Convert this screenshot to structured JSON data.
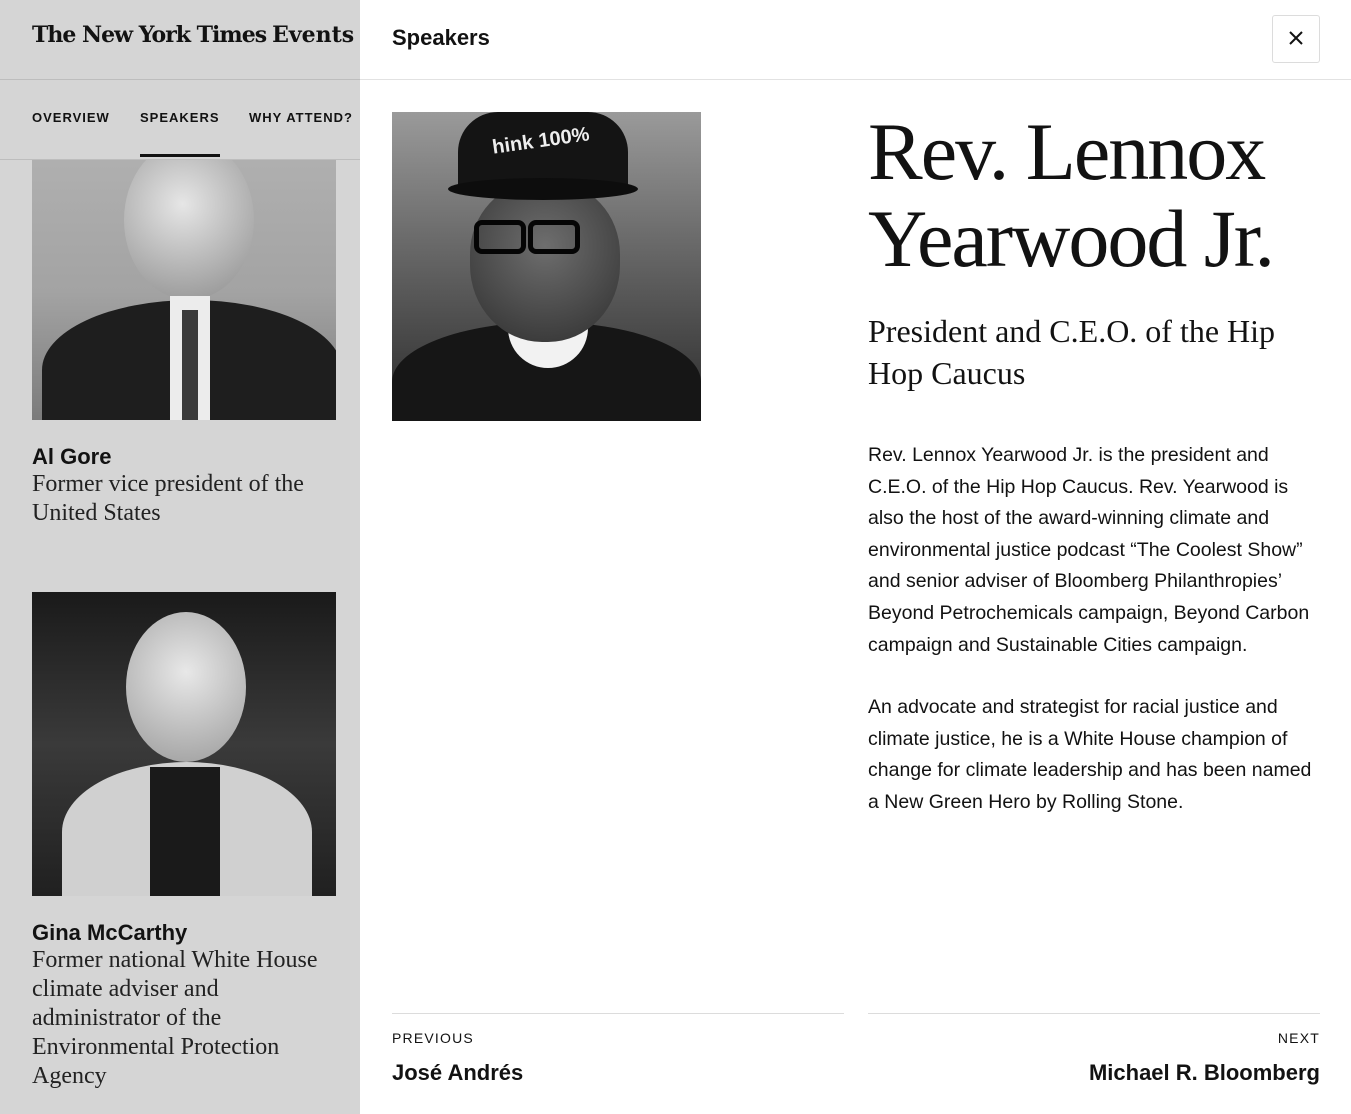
{
  "background": {
    "logo": {
      "wordmark": "The New York Times",
      "suffix": "Events"
    },
    "nav": {
      "tabs": [
        {
          "label": "OVERVIEW",
          "active": false
        },
        {
          "label": "SPEAKERS",
          "active": true
        },
        {
          "label": "WHY ATTEND?",
          "active": false
        }
      ]
    },
    "speakers": [
      {
        "name": "Al Gore",
        "title": "Former vice president of the United States"
      },
      {
        "name": "Gina McCarthy",
        "title": "Former national White House climate adviser and administrator of the Environmental Protection Agency"
      }
    ]
  },
  "modal": {
    "title": "Speakers",
    "close_icon": "close-icon",
    "speaker": {
      "name": "Rev. Lennox Yearwood Jr.",
      "role": "President and C.E.O. of the Hip Hop Caucus",
      "photo_cap_text": "hink 100%",
      "bio": [
        "Rev. Lennox Yearwood Jr. is the president and C.E.O. of the Hip Hop Caucus. Rev. Yearwood is also the host of the award-winning climate and environmental justice podcast “The Coolest Show” and senior adviser of Bloomberg Philanthropies’ Beyond Petrochemicals campaign, Beyond Carbon campaign and Sustainable Cities campaign.",
        "An advocate and strategist for racial justice and climate justice, he is a White House champion of change for climate leadership and has been named a New Green Hero by Rolling Stone."
      ]
    },
    "pager": {
      "previous": {
        "label": "PREVIOUS",
        "name": "José Andrés"
      },
      "next": {
        "label": "NEXT",
        "name": "Michael R. Bloomberg"
      }
    }
  },
  "colors": {
    "backdrop": "#d5d5d5",
    "text": "#121212",
    "divider": "#dcdcdc"
  }
}
